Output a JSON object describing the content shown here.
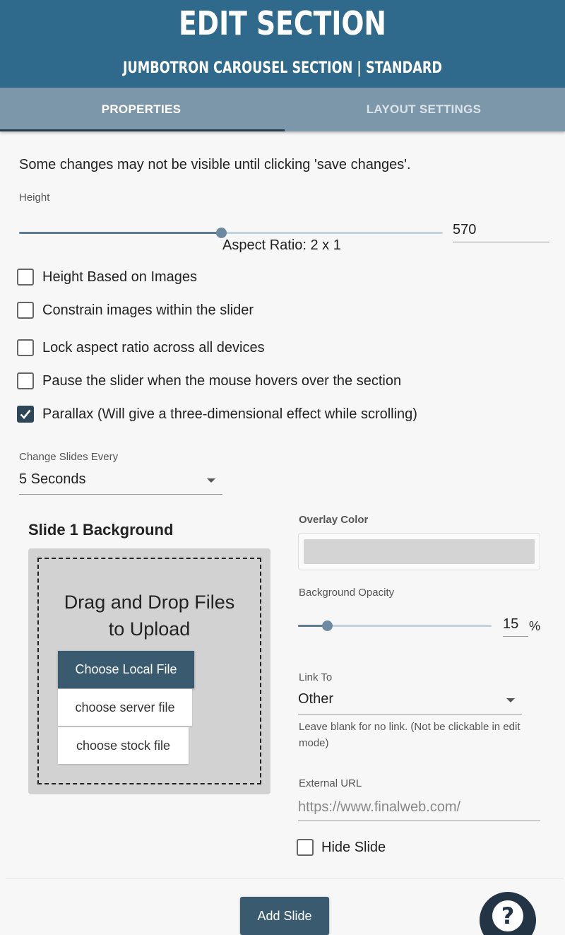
{
  "header": {
    "title": "EDIT SECTION",
    "subtitle": "JUMBOTRON CAROUSEL SECTION | STANDARD"
  },
  "tabs": [
    {
      "label": "PROPERTIES",
      "active": true
    },
    {
      "label": "LAYOUT SETTINGS",
      "active": false
    }
  ],
  "notice": "Some changes may not be visible until clicking 'save changes'.",
  "height": {
    "label": "Height",
    "value": "570",
    "slider_fraction": 0.477,
    "aspect_ratio": "Aspect Ratio: 2 x 1"
  },
  "options": [
    {
      "label": "Height Based on Images",
      "checked": false
    },
    {
      "label": "Constrain images within the slider",
      "checked": false
    },
    {
      "label": "Lock aspect ratio across all devices",
      "checked": false
    },
    {
      "label": "Pause the slider when the mouse hovers over the section",
      "checked": false
    },
    {
      "label": "Parallax (Will give a three-dimensional effect while scrolling)",
      "checked": true
    }
  ],
  "change_slides": {
    "label": "Change Slides Every",
    "value": "5 Seconds"
  },
  "slide": {
    "title": "Slide 1 Background",
    "drop_text_line1": "Drag and Drop Files",
    "drop_text_line2": "to Upload",
    "choose_local": "Choose Local File",
    "choose_server": "choose server file",
    "choose_stock": "choose stock file"
  },
  "overlay": {
    "label": "Overlay Color",
    "color": "#d4d4d4"
  },
  "opacity": {
    "label": "Background Opacity",
    "value": "15",
    "unit": "%",
    "slider_fraction": 0.15
  },
  "link": {
    "label": "Link To",
    "value": "Other",
    "helper": "Leave blank for no link. (Not be clickable in edit mode)"
  },
  "external_url": {
    "label": "External URL",
    "placeholder": "https://www.finalweb.com/"
  },
  "hide_slide": {
    "label": "Hide Slide",
    "checked": false
  },
  "add_slide": "Add Slide",
  "help_icon": "question-mark-icon",
  "colors": {
    "header": "#2f6a8c",
    "tabs": "#7d97aa",
    "primary": "#3a5a70",
    "help": "#233444"
  }
}
